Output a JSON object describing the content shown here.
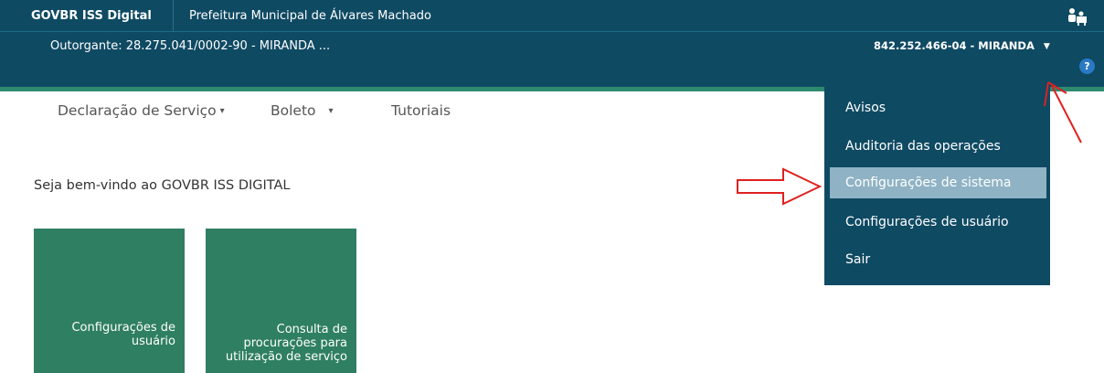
{
  "header": {
    "brand": "GOVBR ISS Digital",
    "prefeitura": "Prefeitura Municipal de Álvares Machado",
    "outorgante": "Outorgante: 28.275.041/0002-90 - MIRANDA ...",
    "user": "842.252.466-04 - MIRANDA",
    "help": "?"
  },
  "nav": {
    "items": [
      {
        "label": "Declaração de Serviço",
        "caret": "▾"
      },
      {
        "label": "Boleto",
        "caret": "▾"
      },
      {
        "label": "Tutoriais"
      }
    ]
  },
  "main": {
    "welcome": "Seja bem-vindo ao GOVBR ISS DIGITAL",
    "tiles": [
      {
        "lines": [
          "Configurações de",
          "usuário"
        ]
      },
      {
        "lines": [
          "Consulta de",
          "procurações para",
          "utilização de serviço"
        ]
      }
    ]
  },
  "user_menu": {
    "items": [
      {
        "label": "Avisos"
      },
      {
        "label": "Auditoria das operações"
      },
      {
        "label": "Configurações de sistema",
        "highlighted": true
      },
      {
        "label": "Configurações de usuário"
      },
      {
        "label": "Sair"
      }
    ]
  },
  "colors": {
    "header_bg": "#0f4a63",
    "green_strip": "#2e8a6e",
    "tile_bg": "#2f7f62",
    "menu_highlight": "#8fb3c5",
    "annotation_red": "#e02020"
  }
}
